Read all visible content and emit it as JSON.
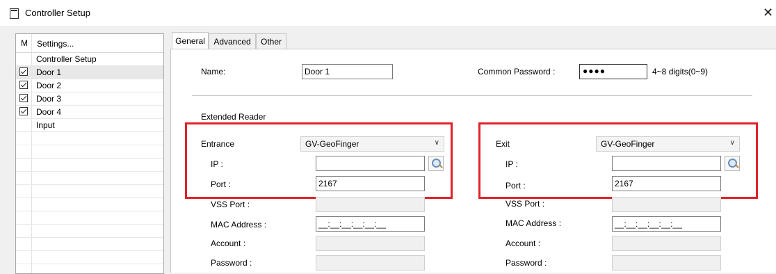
{
  "window": {
    "title": "Controller Setup",
    "close": "✕"
  },
  "tree": {
    "col_m": "M",
    "col_settings": "Settings...",
    "items": [
      {
        "label": "Controller Setup",
        "checked": false
      },
      {
        "label": "Door 1",
        "checked": true,
        "selected": true
      },
      {
        "label": "Door 2",
        "checked": true
      },
      {
        "label": "Door 3",
        "checked": true
      },
      {
        "label": "Door 4",
        "checked": true
      },
      {
        "label": "Input",
        "checked": false
      }
    ]
  },
  "tabs": [
    {
      "label": "General",
      "active": true
    },
    {
      "label": "Advanced",
      "active": false
    },
    {
      "label": "Other",
      "active": false
    }
  ],
  "general": {
    "name_label": "Name:",
    "name_value": "Door 1",
    "common_password_label": "Common Password :",
    "common_password_value": "●●●●",
    "password_hint": "4~8 digits(0~9)",
    "extended_reader_label": "Extended Reader",
    "entrance": {
      "label": "Entrance",
      "reader": "GV-GeoFinger",
      "ip_label": "IP :",
      "ip_value": "",
      "port_label": "Port :",
      "port_value": "2167",
      "vss_port_label": "VSS Port :",
      "mac_label": "MAC Address :",
      "mac_value": "__:__:__:__:__:__",
      "account_label": "Account :",
      "password_label": "Password :"
    },
    "exit": {
      "label": "Exit",
      "reader": "GV-GeoFinger",
      "ip_label": "IP :",
      "ip_value": "",
      "port_label": "Port :",
      "port_value": "2167",
      "vss_port_label": "VSS Port :",
      "mac_label": "MAC Address :",
      "mac_value": "__:__:__:__:__:__",
      "account_label": "Account :",
      "password_label": "Password :"
    }
  },
  "colors": {
    "highlight_box": "#e0222a",
    "selected_row": "#e8e8e8"
  },
  "icons": [
    "window-icon",
    "close-icon",
    "checkbox-icon",
    "search-icon",
    "chevron-down-icon"
  ]
}
